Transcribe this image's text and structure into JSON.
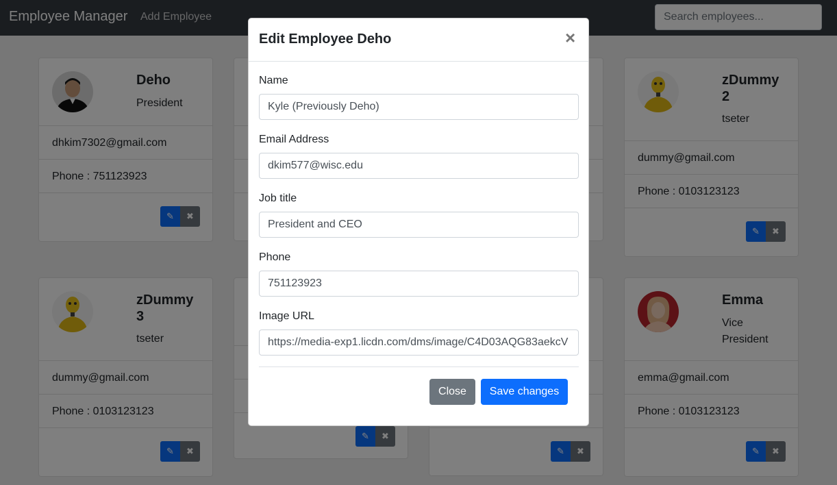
{
  "navbar": {
    "brand": "Employee Manager",
    "add_link": "Add Employee",
    "search_placeholder": "Search employees..."
  },
  "cards": [
    {
      "name": "Deho",
      "job": "President",
      "email": "dhkim7302@gmail.com",
      "phone": "Phone : 751123923",
      "avatar": "person-photo"
    },
    {
      "name": "zDummy 2",
      "job": "tseter",
      "email": "dummy@gmail.com",
      "phone": "Phone : 0103123123",
      "avatar": "crash-dummy-photo"
    },
    {
      "name": "zDummy 3",
      "job": "tseter",
      "email": "dummy@gmail.com",
      "phone": "Phone : 0103123123",
      "avatar": "crash-dummy-photo"
    },
    {
      "name": "Emma",
      "job": "Vice President",
      "email": "emma@gmail.com",
      "phone": "Phone : 0103123123",
      "avatar": "person-photo"
    }
  ],
  "card_actions": {
    "edit_icon": "pencil-icon",
    "delete_icon": "x-icon"
  },
  "modal": {
    "title": "Edit Employee Deho",
    "close_symbol": "×",
    "fields": {
      "name_label": "Name",
      "name_value": "Kyle (Previously Deho)",
      "email_label": "Email Address",
      "email_value": "dkim577@wisc.edu",
      "job_label": "Job title",
      "job_value": "President and CEO",
      "phone_label": "Phone",
      "phone_value": "751123923",
      "image_label": "Image URL",
      "image_value": "https://media-exp1.licdn.com/dms/image/C4D03AQG83aekcV"
    },
    "close_button": "Close",
    "save_button": "Save changes"
  },
  "colors": {
    "navbar": "#343a40",
    "primary": "#0d6efd",
    "secondary": "#6c757d"
  }
}
